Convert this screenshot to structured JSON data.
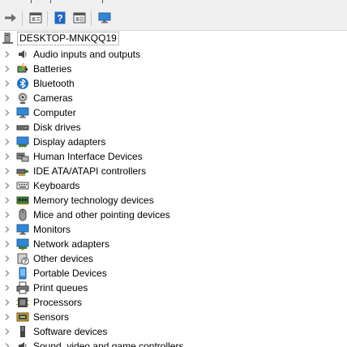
{
  "colors": {
    "toolbar_bg": "#f0f0f0",
    "tree_bg": "#ffffff",
    "accent_blue": "#1e73c8",
    "chevron": "#808080"
  },
  "toolbar": {
    "buttons": [
      {
        "name": "forward-button",
        "icon": "arrow-right-icon"
      },
      {
        "name": "properties-button",
        "icon": "properties-icon"
      },
      {
        "name": "help-button",
        "icon": "help-icon"
      },
      {
        "name": "view-button",
        "icon": "console-view-icon"
      },
      {
        "name": "scan-hardware-button",
        "icon": "monitor-icon"
      }
    ]
  },
  "tree": {
    "root": {
      "label": "DESKTOP-MNKQQ19",
      "icon": "computer-tower-icon"
    },
    "categories": [
      {
        "label": "Audio inputs and outputs",
        "icon": "speaker-icon"
      },
      {
        "label": "Batteries",
        "icon": "battery-icon"
      },
      {
        "label": "Bluetooth",
        "icon": "bluetooth-icon"
      },
      {
        "label": "Cameras",
        "icon": "camera-icon"
      },
      {
        "label": "Computer",
        "icon": "computer-icon"
      },
      {
        "label": "Disk drives",
        "icon": "disk-drive-icon"
      },
      {
        "label": "Display adapters",
        "icon": "display-adapter-icon"
      },
      {
        "label": "Human Interface Devices",
        "icon": "hid-icon"
      },
      {
        "label": "IDE ATA/ATAPI controllers",
        "icon": "ide-controller-icon"
      },
      {
        "label": "Keyboards",
        "icon": "keyboard-icon"
      },
      {
        "label": "Memory technology devices",
        "icon": "memory-icon"
      },
      {
        "label": "Mice and other pointing devices",
        "icon": "mouse-icon"
      },
      {
        "label": "Monitors",
        "icon": "monitor-icon"
      },
      {
        "label": "Network adapters",
        "icon": "network-adapter-icon"
      },
      {
        "label": "Other devices",
        "icon": "unknown-device-icon"
      },
      {
        "label": "Portable Devices",
        "icon": "portable-device-icon"
      },
      {
        "label": "Print queues",
        "icon": "printer-icon"
      },
      {
        "label": "Processors",
        "icon": "processor-icon"
      },
      {
        "label": "Sensors",
        "icon": "sensor-icon"
      },
      {
        "label": "Software devices",
        "icon": "software-device-icon"
      },
      {
        "label": "Sound, video and game controllers",
        "icon": "sound-controller-icon"
      }
    ]
  }
}
